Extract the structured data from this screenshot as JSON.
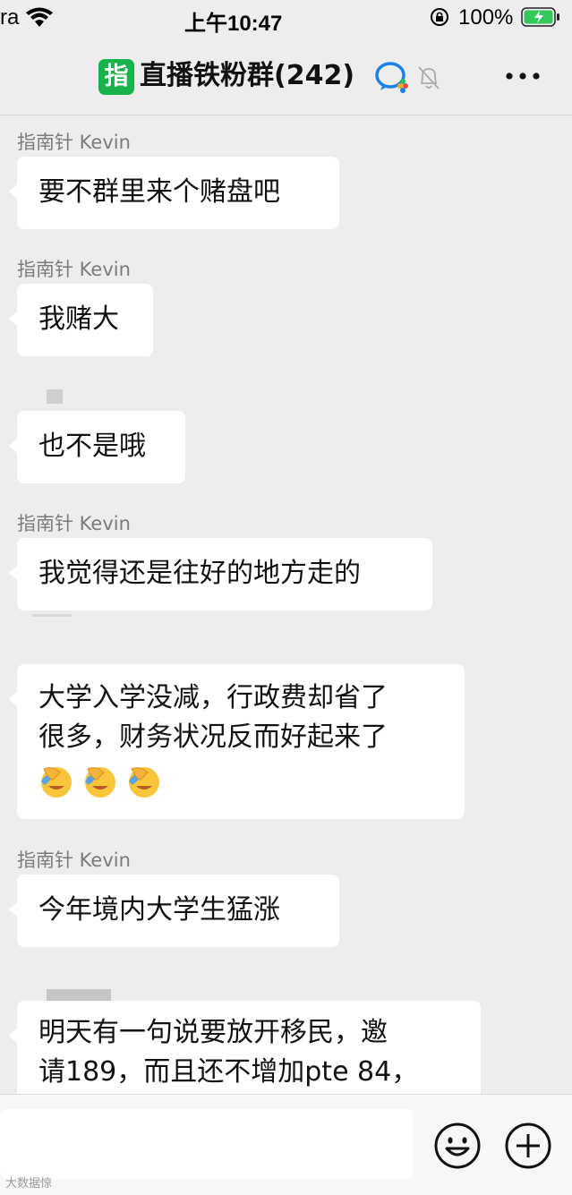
{
  "status_bar": {
    "carrier": "ra",
    "time": "上午10:47",
    "battery_percent": "100%"
  },
  "nav": {
    "group_avatar_text": "指",
    "title": "直播铁粉群(242)"
  },
  "messages": [
    {
      "sender": "指南针 Kevin",
      "lines": [
        "要不群里来个赌盘吧"
      ]
    },
    {
      "sender": "指南针 Kevin",
      "lines": [
        "我赌大"
      ]
    },
    {
      "sender": "",
      "lines": [
        "也不是哦"
      ]
    },
    {
      "sender": "指南针 Kevin",
      "lines": [
        "我觉得还是往好的地方走的"
      ]
    },
    {
      "sender": "",
      "lines": [
        "大学入学没减，行政费却省了",
        "很多，财务状况反而好起来了"
      ],
      "emojis": [
        "facepalm-icon",
        "facepalm-icon",
        "facepalm-icon"
      ]
    },
    {
      "sender": "指南针 Kevin",
      "lines": [
        "今年境内大学生猛涨"
      ]
    },
    {
      "sender": "",
      "lines": [
        "明天有一句说要放开移民，邀",
        "请189，而且还不增加pte 84，"
      ]
    }
  ],
  "watermark": "大数据惊",
  "colors": {
    "background": "#ededed",
    "bubble": "#ffffff",
    "group_avatar": "#18b24a",
    "battery_fill": "#34c759"
  }
}
